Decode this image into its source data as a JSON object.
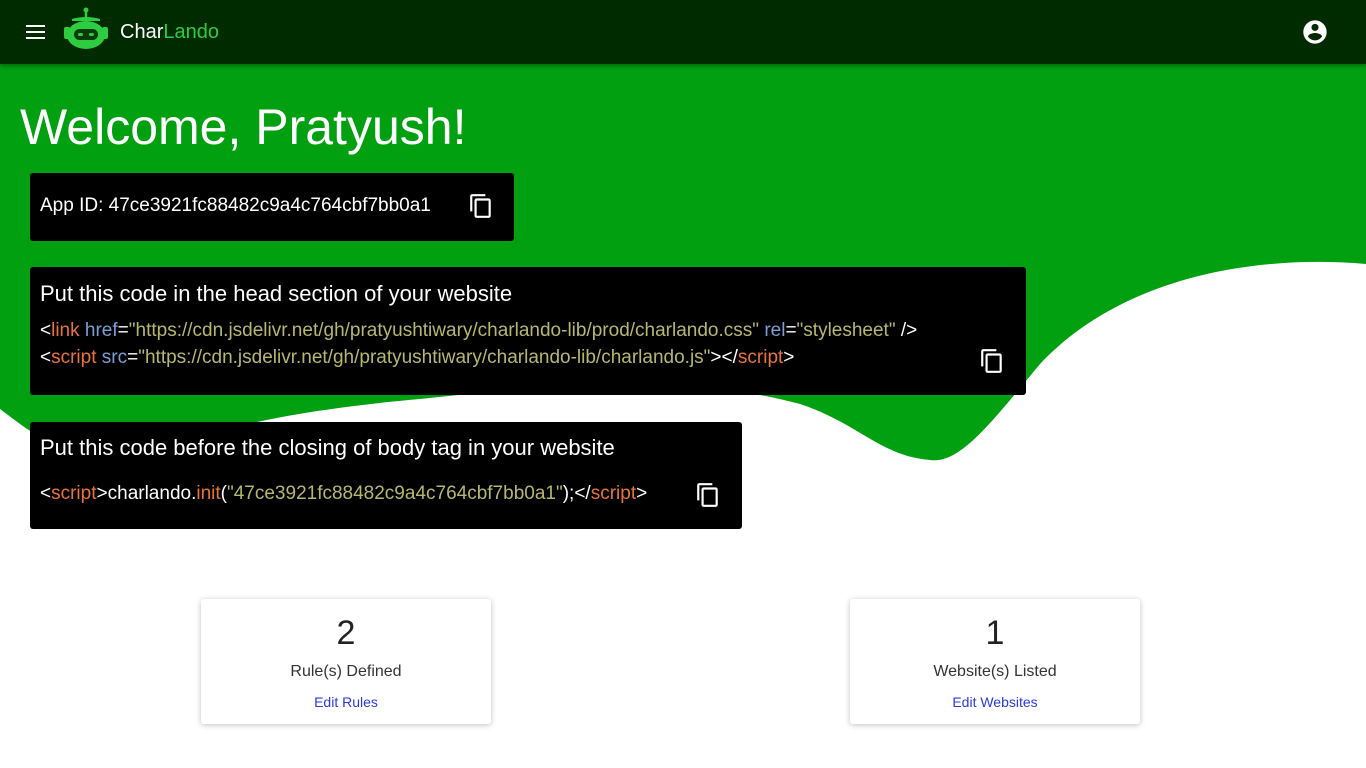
{
  "appbar": {
    "brand_part1": "Char",
    "brand_part2": "Lando",
    "brand_accent_color": "#2ecc40",
    "background_color": "#002b00",
    "menu_icon": "hamburger-menu-icon",
    "logo_icon": "robot-logo-icon",
    "account_icon": "account-circle-icon"
  },
  "hero": {
    "background_color": "#00a010",
    "welcome": "Welcome, Pratyush!"
  },
  "app_id": {
    "label": "App ID: 47ce3921fc88482c9a4c764cbf7bb0a1",
    "copy_icon": "copy-icon"
  },
  "head_code": {
    "title": "Put this code in the head section of your website",
    "line1": {
      "open": "<",
      "tag": "link",
      "attr1": "href",
      "eq1": "=",
      "val1": "\"https://cdn.jsdelivr.net/gh/pratyushtiwary/charlando-lib/prod/charlando.css\"",
      "attr2": "rel",
      "eq2": "=",
      "val2": "\"stylesheet\"",
      "close": " />"
    },
    "line2": {
      "open": "<",
      "tag": "script",
      "attr1": "src",
      "eq1": "=",
      "val1": "\"https://cdn.jsdelivr.net/gh/pratyushtiwary/charlando-lib/charlando.js\"",
      "mid": "></",
      "tag_close": "script",
      "end": ">"
    },
    "copy_icon": "copy-icon"
  },
  "body_code": {
    "title": "Put this code before the closing of body tag in your website",
    "line": {
      "open": "<",
      "tag": "script",
      "gt": ">",
      "obj": "charlando.",
      "fn": "init",
      "paren_open": "(",
      "arg": "\"47ce3921fc88482c9a4c764cbf7bb0a1\"",
      "paren_close": ");</",
      "tag_close": "script",
      "end": ">"
    },
    "copy_icon": "copy-icon"
  },
  "stats": [
    {
      "value": "2",
      "label": "Rule(s) Defined",
      "link": "Edit Rules"
    },
    {
      "value": "1",
      "label": "Website(s) Listed",
      "link": "Edit Websites"
    }
  ],
  "colors": {
    "tag": "#e8743b",
    "attr": "#7a9ed6",
    "string": "#b5b86e",
    "link": "#2a3bd8"
  }
}
